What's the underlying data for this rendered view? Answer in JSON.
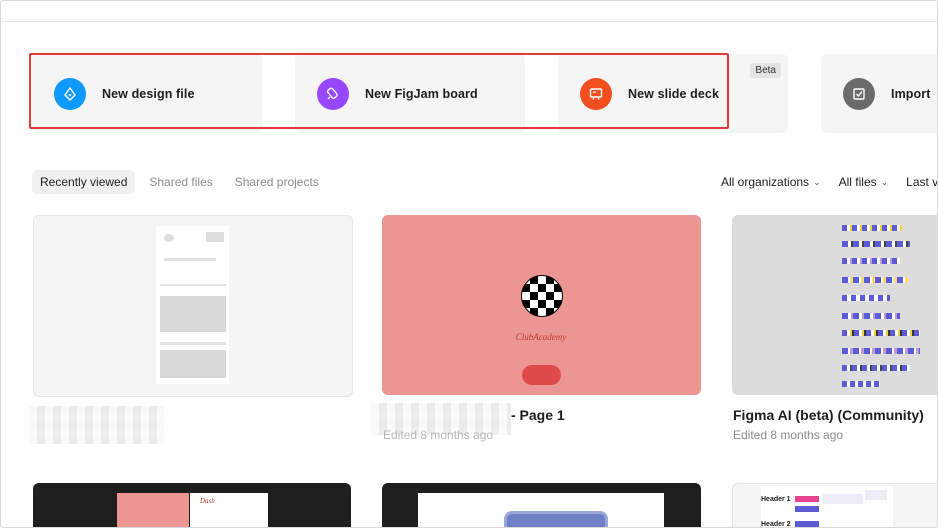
{
  "actions": [
    {
      "label": "New design file",
      "icon": "pen-nib-icon",
      "color": "#0d99ff"
    },
    {
      "label": "New FigJam board",
      "icon": "marker-icon",
      "color": "#9747ff"
    },
    {
      "label": "New slide deck",
      "icon": "slides-icon",
      "color": "#f24e1e",
      "badge": "Beta"
    },
    {
      "label": "Import",
      "icon": "import-icon",
      "color": "#6b6b6b"
    }
  ],
  "tabs": [
    {
      "label": "Recently viewed",
      "active": true
    },
    {
      "label": "Shared files",
      "active": false
    },
    {
      "label": "Shared projects",
      "active": false
    }
  ],
  "filters": {
    "organizations": "All organizations",
    "files": "All files",
    "sort": "Last vi"
  },
  "files": [
    {
      "title": "",
      "subtitle": ""
    },
    {
      "title": "- Page 1",
      "subtitle": "Edited 8 months ago",
      "thumb_text": "ClubAcademy"
    },
    {
      "title": "Figma AI (beta) (Community)",
      "subtitle": "Edited 8 months ago"
    }
  ],
  "bottom_row": {
    "thumb1_text": "Dash",
    "thumb3_header1": "Header 1",
    "thumb3_header2": "Header 2"
  },
  "colors": {
    "design": "#0d99ff",
    "figjam": "#9747ff",
    "slides": "#f24e1e",
    "import": "#6b6b6b",
    "highlight": "#e53935",
    "pink_thumb": "#ec9694"
  }
}
